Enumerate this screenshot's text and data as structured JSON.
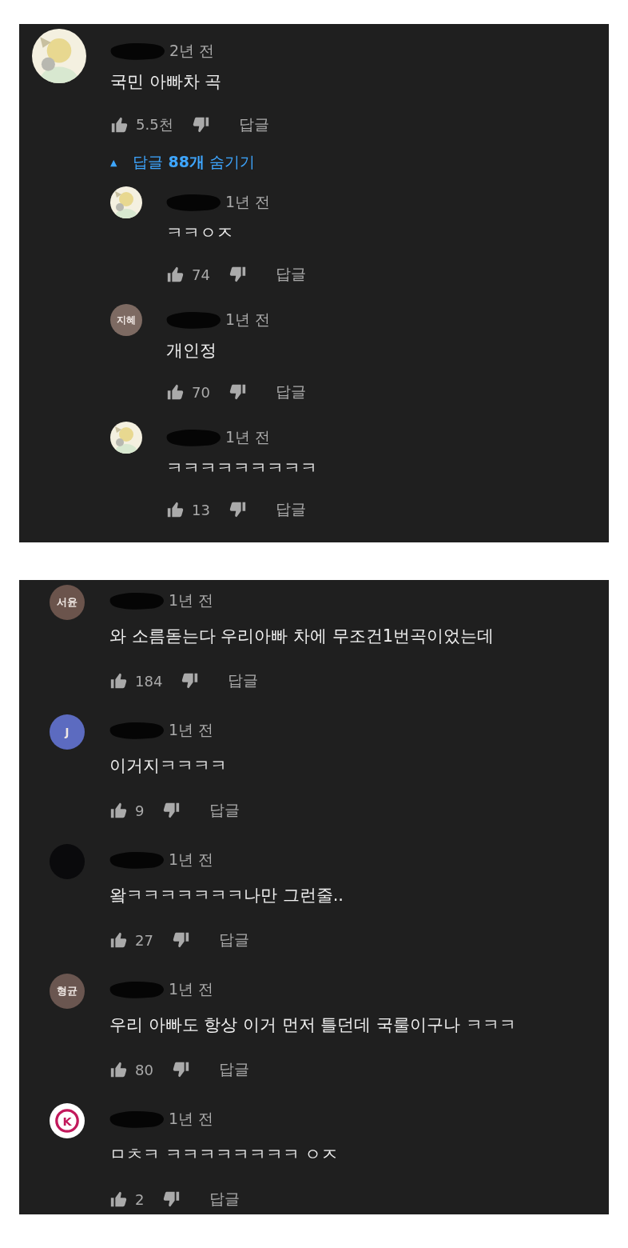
{
  "panels": [
    {
      "comments": [
        {
          "time": "2년 전",
          "text": "국민 아빠차 곡",
          "likes": "5.5천",
          "reply": "답글",
          "replies_toggle": {
            "caret": "▲",
            "text": "답글 **88개** 숨기기",
            "expanded": true
          },
          "replies": [
            {
              "time": "1년 전",
              "text": "ㅋㅋㅇㅈ",
              "likes": "74",
              "reply": "답글"
            },
            {
              "avatar": {
                "kind": "initials",
                "text": "지혜",
                "color": "#7d6a62"
              },
              "time": "1년 전",
              "text": "개인정",
              "likes": "70",
              "reply": "답글"
            },
            {
              "time": "1년 전",
              "text": "ㅋㅋㅋㅋㅋㅋㅋㅋㅋ",
              "likes": "13",
              "reply": "답글"
            }
          ]
        }
      ]
    },
    {
      "comments": [
        {
          "avatar": {
            "kind": "initials",
            "text": "서윤",
            "color": "#6b544c"
          },
          "time": "1년 전",
          "text": "와 소름돋는다 우리아빠 차에 무조건1번곡이었는데",
          "likes": "184",
          "reply": "답글"
        },
        {
          "avatar": {
            "kind": "initials",
            "text": "J",
            "color": "#5c6bc0"
          },
          "time": "1년 전",
          "text": "이거지ㅋㅋㅋㅋ",
          "likes": "9",
          "reply": "답글"
        },
        {
          "avatar": {
            "kind": "blank",
            "color": "#0a0a0c"
          },
          "time": "1년 전",
          "text": "왘ㅋㅋㅋㅋㅋㅋㅋ나만 그런줄..",
          "likes": "27",
          "reply": "답글"
        },
        {
          "avatar": {
            "kind": "initials",
            "text": "형균",
            "color": "#6a5650"
          },
          "time": "1년 전",
          "text": "우리 아빠도 항상 이거 먼저 틀던데 국룰이구나 ㅋㅋㅋ",
          "likes": "80",
          "reply": "답글"
        },
        {
          "avatar": {
            "kind": "logo",
            "text": "K",
            "color": "#c2185b"
          },
          "time": "1년 전",
          "text": "ㅁㅊㅋ ㅋㅋㅋㅋㅋㅋㅋㅋ ㅇㅈ",
          "likes": "2",
          "reply": "답글"
        }
      ]
    }
  ]
}
